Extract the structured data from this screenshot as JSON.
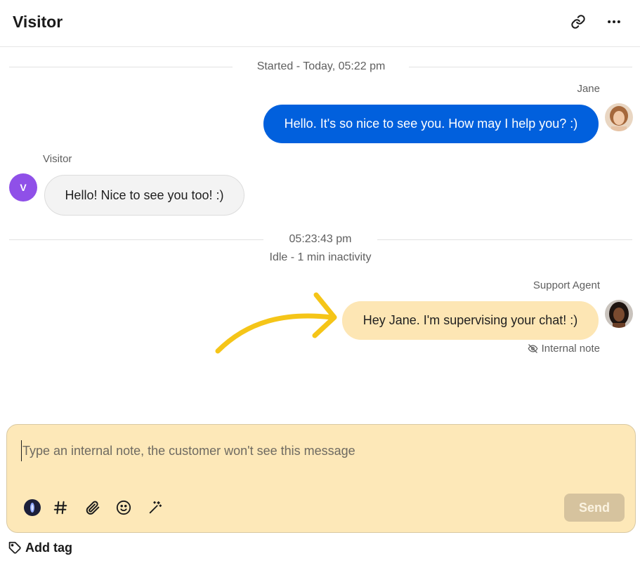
{
  "header": {
    "title": "Visitor",
    "link_icon": "link-icon",
    "more_icon": "more-horizontal-icon"
  },
  "chat": {
    "started_text": "Started - Today, 05:22 pm",
    "messages": [
      {
        "author": "Jane",
        "text": "Hello. It's so nice to see you. How may I help you? :)",
        "side": "right",
        "style": "agent"
      },
      {
        "author": "Visitor",
        "avatar_letter": "V",
        "text": "Hello! Nice to see you too! :)",
        "side": "left",
        "style": "visitor"
      },
      {
        "author": "Support Agent",
        "text": "Hey Jane. I'm supervising your chat! :)",
        "side": "right",
        "style": "internal-note",
        "meta": "Internal note"
      }
    ],
    "idle_time": "05:23:43 pm",
    "idle_text": "Idle - 1 min inactivity"
  },
  "composer": {
    "placeholder": "Type an internal note, the customer won't see this message",
    "send_label": "Send",
    "tools": [
      "ai-orb-icon",
      "hashtag-icon",
      "paperclip-icon",
      "emoji-icon",
      "magic-wand-icon"
    ]
  },
  "footer": {
    "add_tag_label": "Add tag"
  },
  "colors": {
    "agent_bubble": "#0160dd",
    "visitor_avatar": "#8f50e8",
    "note_bubble": "#fde6b4",
    "composer_bg": "#fde8b8",
    "arrow": "#f5c518"
  }
}
